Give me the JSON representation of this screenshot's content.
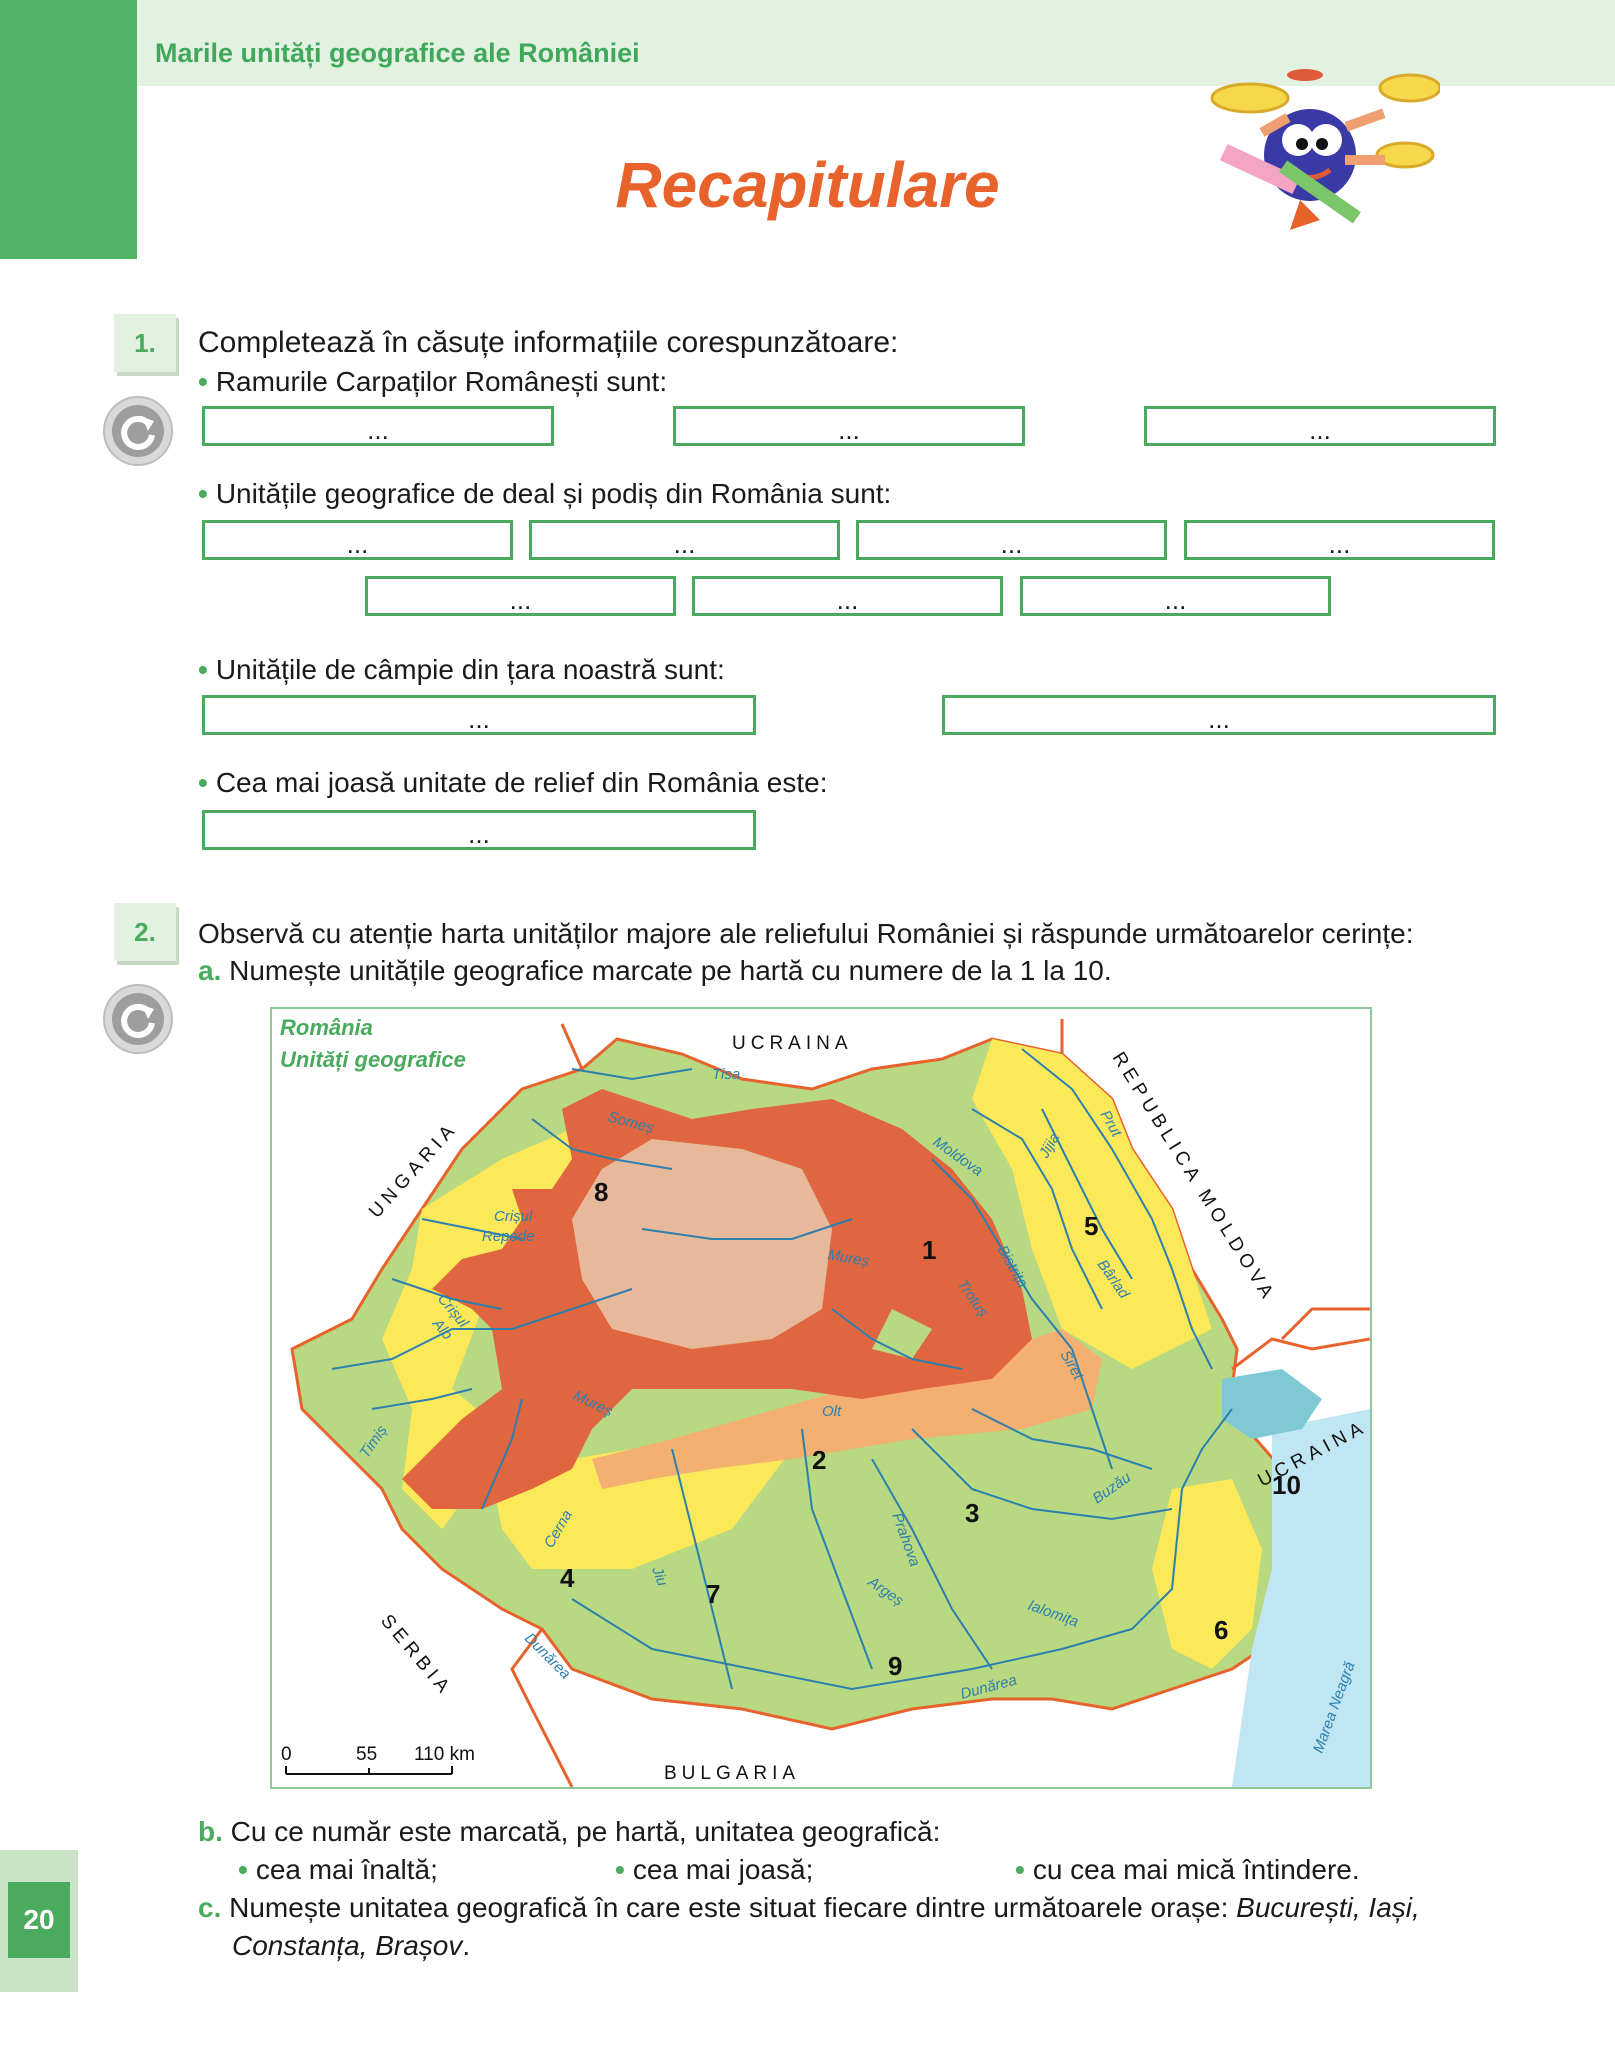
{
  "header": {
    "section_title": "Marile unități geografice ale României",
    "page_title": "Recapitulare"
  },
  "ex1": {
    "number": "1.",
    "instruction": "Completează în căsuțe informațiile corespunzătoare:",
    "q1": "Ramurile Carpaților Românești sunt:",
    "q2": "Unitățile geografice de deal și podiș din România sunt:",
    "q3": "Unitățile de câmpie din țara noastră sunt:",
    "q4": "Cea mai joasă unitate de relief din România este:",
    "blank": "..."
  },
  "ex2": {
    "number": "2.",
    "instruction": "Observă cu atenție harta unităților majore ale reliefului României și răspunde următoarelor cerințe:",
    "a_letter": "a.",
    "a_text": "Numește unitățile geografice marcate pe hartă cu numere de la 1 la 10.",
    "b_letter": "b.",
    "b_text": "Cu ce număr este marcată, pe hartă, unitatea geografică:",
    "b_opt1": "cea mai înaltă;",
    "b_opt2": "cea mai joasă;",
    "b_opt3": "cu cea mai mică întindere.",
    "c_letter": "c.",
    "c_text": "Numește unitatea geografică în care este situat fiecare dintre următoarele orașe:",
    "c_cities_line1": "București, Iași,",
    "c_cities_line2": "Constanța, Brașov",
    "c_end": "."
  },
  "map": {
    "title1": "România",
    "title2": "Unități geografice",
    "countries": {
      "ucraina_n": "UCRAINA",
      "moldova": "REPUBLICA MOLDOVA",
      "ungaria": "UNGARIA",
      "ucraina_e": "UCRAINA",
      "serbia": "SERBIA",
      "bulgaria": "BULGARIA"
    },
    "rivers": {
      "tisa": "Tisa",
      "somes": "Someș",
      "crisul_repede1": "Crișul",
      "crisul_repede2": "Repede",
      "crisul_alb1": "Crișul",
      "crisul_alb2": "Alb",
      "mures1": "Mureș",
      "mures2": "Mureș",
      "timis": "Timiș",
      "cerna": "Cerna",
      "jiu": "Jiu",
      "olt": "Olt",
      "arges": "Argeș",
      "prahova": "Prahova",
      "ialomita": "Ialomița",
      "buzau": "Buzău",
      "siret": "Siret",
      "bistrita": "Bistrița",
      "trotus": "Trotuș",
      "moldova_r": "Moldova",
      "jijia": "Jijia",
      "prut": "Prut",
      "barlad": "Bârlad",
      "dunarea1": "Dunărea",
      "dunarea2": "Dunărea",
      "marea": "Marea Neagră"
    },
    "numbers": [
      "1",
      "2",
      "3",
      "4",
      "5",
      "6",
      "7",
      "8",
      "9",
      "10"
    ],
    "scale": {
      "s0": "0",
      "s1": "55",
      "s2": "110 km"
    },
    "colors": {
      "mountains": "#e0663f",
      "plateau": "#e8b89b",
      "subcarp": "#f3b071",
      "hills": "#fbe95a",
      "plains": "#b8d882",
      "delta": "#7fc9d4",
      "sea": "#bfe6f2",
      "river": "#2d7fae",
      "border": "#e8622c"
    }
  },
  "footer": {
    "page_number": "20"
  }
}
